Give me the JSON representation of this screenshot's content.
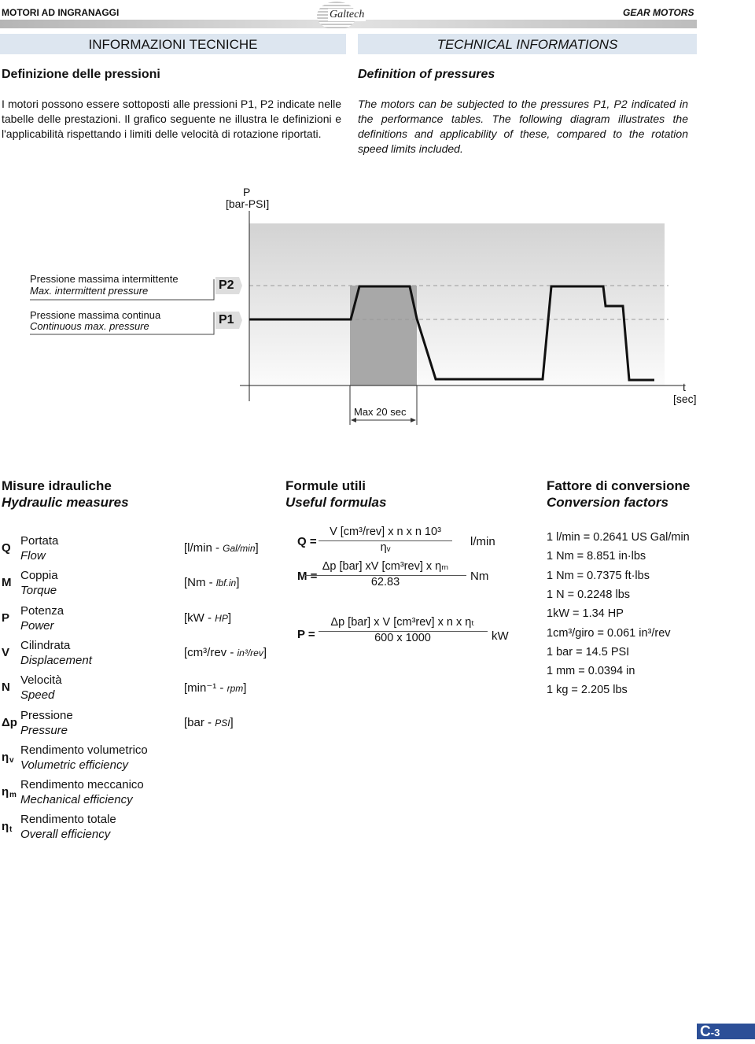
{
  "header": {
    "left": "MOTORI AD INGRANAGGI",
    "right": "GEAR MOTORS",
    "logo": "Galtech"
  },
  "it": {
    "band": "INFORMAZIONI TECNICHE",
    "title": "Definizione delle pressioni",
    "body": "I motori possono essere sottoposti alle pressioni P1, P2 indicate nelle tabelle delle prestazioni. Il grafico seguente ne illustra le definizioni e l'applicabilità rispettando i limiti delle velocità di rotazione riportati."
  },
  "en": {
    "band": "TECHNICAL INFORMATIONS",
    "title": "Definition of pressures",
    "body": "The motors can be subjected to the pressures P1, P2 indicated in the performance tables. The following diagram illustrates the definitions and applicability of these, compared to the rotation speed limits included."
  },
  "diagram": {
    "y_label": "P",
    "y_unit": "[bar-PSI]",
    "x_label": "t",
    "x_unit": "[sec]",
    "p2": "P2",
    "p1": "P1",
    "p2_it": "Pressione massima intermittente",
    "p2_en": "Max. intermittent pressure",
    "p1_it": "Pressione massima continua",
    "p1_en": "Continuous max. pressure",
    "window": "Max 20 sec"
  },
  "sections": {
    "measures_it": "Misure idrauliche",
    "measures_en": "Hydraulic measures",
    "formulas_it": "Formule utili",
    "formulas_en": "Useful formulas",
    "conv_it": "Fattore di conversione",
    "conv_en": "Conversion factors"
  },
  "measures": [
    {
      "sym": "Q",
      "sub": "",
      "it": "Portata",
      "en": "Flow",
      "unit": "[l/min - ",
      "alt": "Gal/min",
      "end": "]"
    },
    {
      "sym": "M",
      "sub": "",
      "it": "Coppia",
      "en": "Torque",
      "unit": "[Nm - ",
      "alt": "lbf.in",
      "end": "]"
    },
    {
      "sym": "P",
      "sub": "",
      "it": "Potenza",
      "en": "Power",
      "unit": "[kW - ",
      "alt": "HP",
      "end": "]"
    },
    {
      "sym": "V",
      "sub": "",
      "it": "Cilindrata",
      "en": "Displacement",
      "unit": "[cm³/rev - ",
      "alt": "in³/rev",
      "end": "]"
    },
    {
      "sym": "N",
      "sub": "",
      "it": "Velocità",
      "en": "Speed",
      "unit": "[min⁻¹ - ",
      "alt": "rpm",
      "end": "]"
    },
    {
      "sym": "Δp",
      "sub": "",
      "it": "Pressione",
      "en": "Pressure",
      "unit": "[bar - ",
      "alt": "PSI",
      "end": "]"
    },
    {
      "sym": "η",
      "sub": "v",
      "it": "Rendimento volumetrico",
      "en": "Volumetric efficiency"
    },
    {
      "sym": "η",
      "sub": "m",
      "it": "Rendimento meccanico",
      "en": "Mechanical efficiency"
    },
    {
      "sym": "η",
      "sub": "t",
      "it": "Rendimento totale",
      "en": "Overall efficiency"
    }
  ],
  "formulas": [
    {
      "lhs": "Q =",
      "num": "V [cm³/rev] x n x n 10³",
      "den": "ηᵥ",
      "unit": "l/min"
    },
    {
      "lhs": "M =",
      "num": "Δp [bar] xV [cm³rev] x ηₘ",
      "den": "62.83",
      "unit": "Nm"
    },
    {
      "lhs": "P =",
      "num": "Δp [bar] x V [cm³rev] x n x ηₜ",
      "den": "600 x 1000",
      "unit": "kW"
    }
  ],
  "conversions": [
    "1 l/min = 0.2641 US Gal/min",
    "1 Nm = 8.851 in·lbs",
    "1 Nm = 0.7375 ft·lbs",
    "1 N = 0.2248 lbs",
    "1kW = 1.34 HP",
    "1cm³/giro = 0.061 in³/rev",
    "1 bar = 14.5 PSI",
    "1 mm = 0.0394 in",
    "1 kg = 2.205 lbs"
  ],
  "page": {
    "letter": "C",
    "num": "-3",
    "color": "#2c4f97"
  }
}
